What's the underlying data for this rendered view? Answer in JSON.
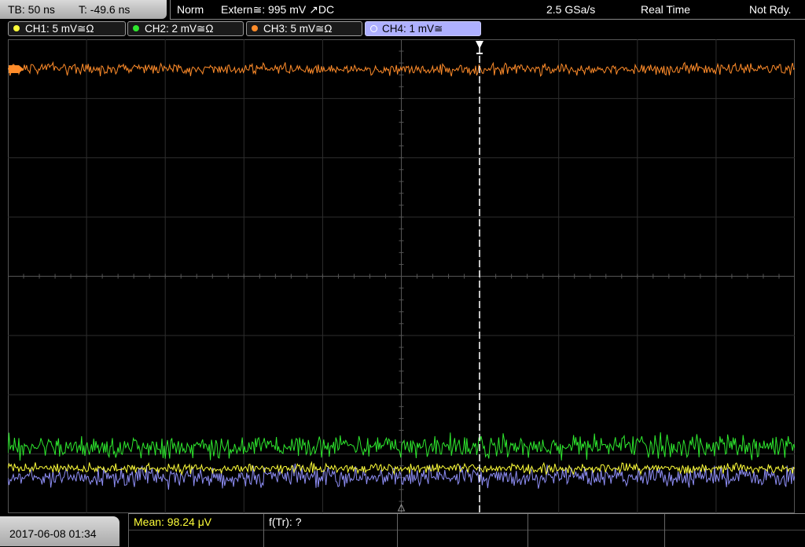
{
  "header": {
    "timebase": "TB: 50 ns",
    "trigger_time": "T: -49.6 ns",
    "mode": "Norm",
    "trigger_source": "Extern≅: 995 mV ↗DC",
    "sample_rate": "2.5 GSa/s",
    "acquisition": "Real Time",
    "state": "Not Rdy."
  },
  "channels": [
    {
      "label": "CH1: 5 mV≅Ω",
      "color": "#ffff3a",
      "active": false
    },
    {
      "label": "CH2: 2 mV≅Ω",
      "color": "#2ee82e",
      "active": false
    },
    {
      "label": "CH3: 5 mV≅Ω",
      "color": "#ff8c2a",
      "active": false
    },
    {
      "label": "CH4: 1 mV≅",
      "color": "#8e8ef5",
      "active": true
    }
  ],
  "footer": {
    "datetime": "2017-06-08 01:34",
    "mean": "Mean: 98.24 μV",
    "ftr": "f(Tr): ?"
  },
  "colors": {
    "ch1": "#ffff3a",
    "ch2": "#2ee82e",
    "ch3": "#ff8c2a",
    "ch4": "#8e8ef5",
    "mean_text": "#ffff3a"
  }
}
